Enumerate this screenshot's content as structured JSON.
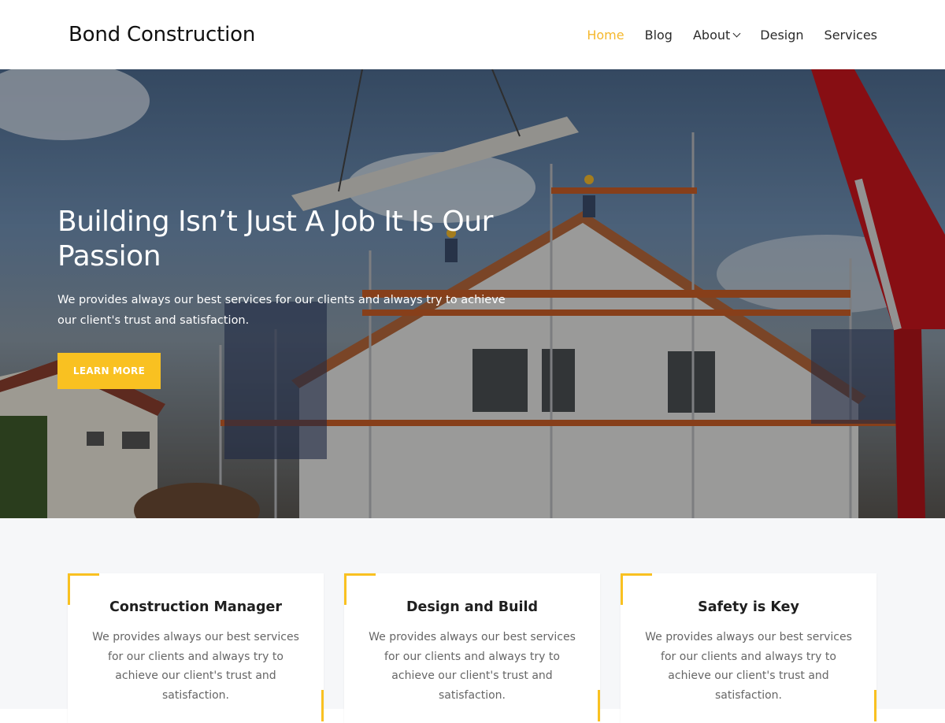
{
  "header": {
    "logo": "Bond Construction",
    "nav": [
      {
        "label": "Home",
        "active": true
      },
      {
        "label": "Blog"
      },
      {
        "label": "About",
        "has_dropdown": true
      },
      {
        "label": "Design"
      },
      {
        "label": "Services"
      }
    ]
  },
  "hero": {
    "title": "Building Isn’t Just A Job It Is Our Passion",
    "subtitle": "We provides always our best services for our clients and always try to achieve our client's trust and satisfaction.",
    "button": "LEARN MORE"
  },
  "services": [
    {
      "title": "Construction Manager",
      "text": "We provides always our best services for our clients and always try to achieve our client's trust and satisfaction."
    },
    {
      "title": "Design and Build",
      "text": "We provides always our best services for our clients and always try to achieve our client's trust and satisfaction."
    },
    {
      "title": "Safety is Key",
      "text": "We provides always our best services for our clients and always try to achieve our client's trust and satisfaction."
    }
  ],
  "colors": {
    "accent": "#f9c121",
    "nav_active": "#f5b82e",
    "section_bg": "#f6f7f9"
  }
}
